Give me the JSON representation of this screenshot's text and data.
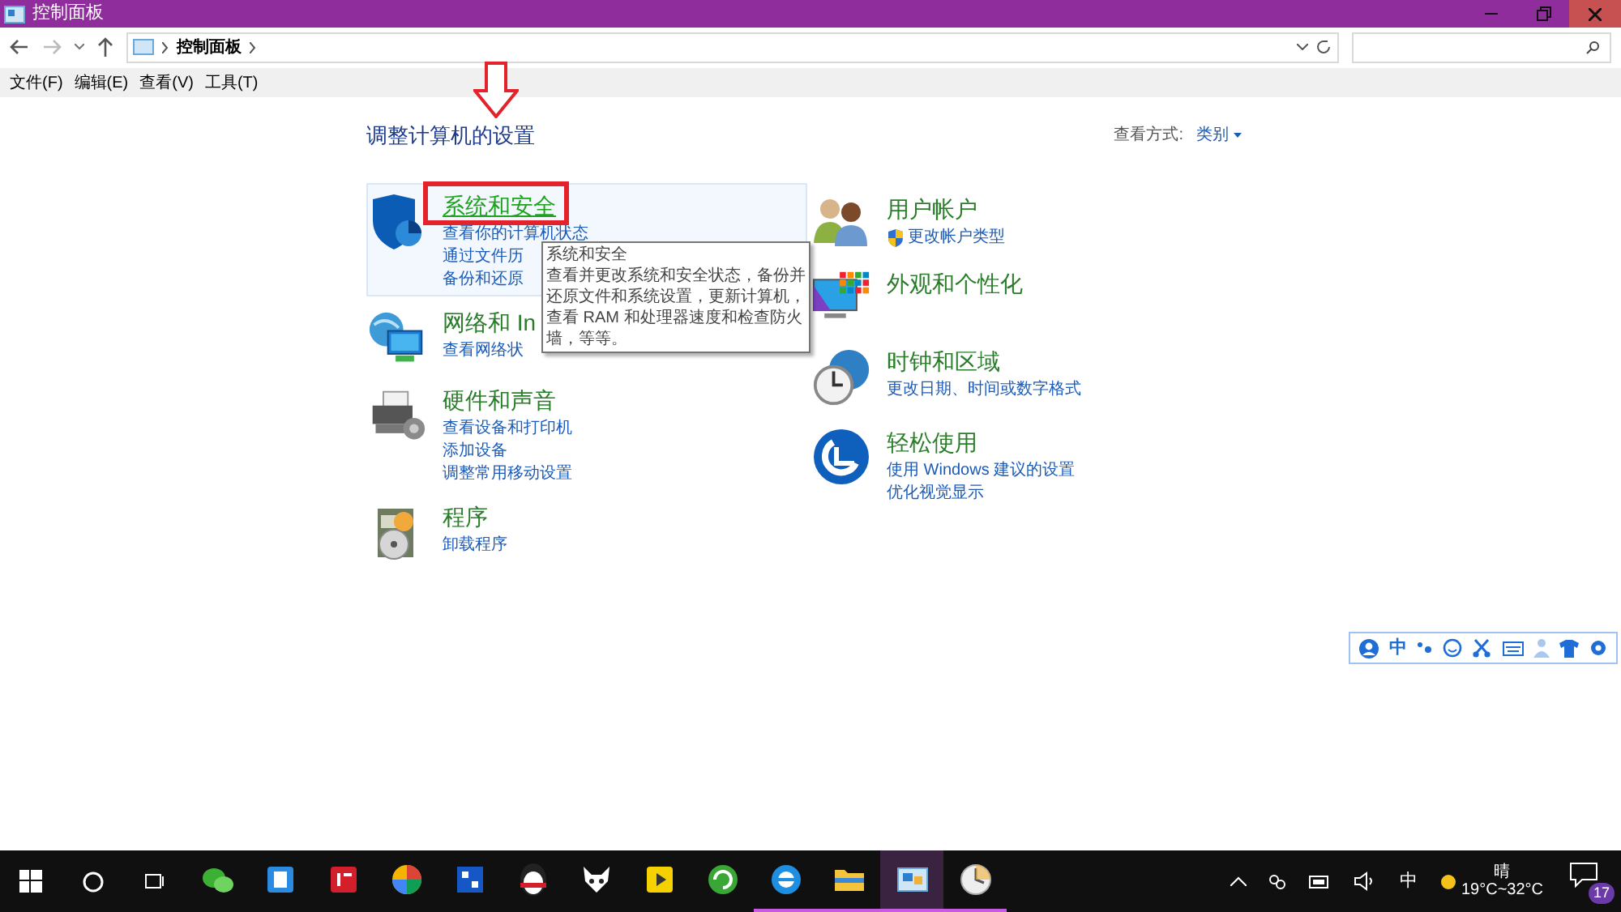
{
  "window": {
    "title": "控制面板"
  },
  "address_bar": {
    "path": "控制面板"
  },
  "menu": [
    "文件(F)",
    "编辑(E)",
    "查看(V)",
    "工具(T)"
  ],
  "heading": "调整计算机的设置",
  "view_by": {
    "label": "查看方式:",
    "value": "类别"
  },
  "left_categories": [
    {
      "kind": "security",
      "title": "系统和安全",
      "selected": true,
      "links": [
        "查看你的计算机状态",
        "通过文件历",
        "备份和还原"
      ]
    },
    {
      "kind": "network",
      "title": "网络和 In",
      "selected": false,
      "links": [
        "查看网络状"
      ]
    },
    {
      "kind": "hardware",
      "title": "硬件和声音",
      "selected": false,
      "links": [
        "查看设备和打印机",
        "添加设备",
        "调整常用移动设置"
      ]
    },
    {
      "kind": "programs",
      "title": "程序",
      "selected": false,
      "links": [
        "卸载程序"
      ]
    }
  ],
  "right_categories": [
    {
      "kind": "accounts",
      "title": "用户帐户",
      "selected": false,
      "links": [
        "更改帐户类型"
      ]
    },
    {
      "kind": "appearance",
      "title": "外观和个性化",
      "selected": false
    },
    {
      "kind": "region",
      "title": "时钟和区域",
      "selected": false,
      "links": [
        "更改日期、时间或数字格式"
      ]
    },
    {
      "kind": "access",
      "title": "轻松使用",
      "selected": false,
      "links": [
        "使用 Windows 建议的设置",
        "优化视觉显示"
      ]
    }
  ],
  "tooltip": {
    "title": "系统和安全",
    "body": "查看并更改系统和安全状态，备份并还原文件和系统设置，更新计算机，查看 RAM 和处理器速度和检查防火墙，等等。"
  },
  "ime_toolbar": {
    "mode": "中"
  },
  "taskbar": {
    "apps": [
      {
        "kind": "wechat",
        "open": false,
        "active": false
      },
      {
        "kind": "blue",
        "open": false,
        "active": false
      },
      {
        "kind": "red",
        "open": false,
        "active": false
      },
      {
        "kind": "colorful",
        "open": false,
        "active": false
      },
      {
        "kind": "tools",
        "open": false,
        "active": false
      },
      {
        "kind": "penguin",
        "open": false,
        "active": false
      },
      {
        "kind": "fox",
        "open": false,
        "active": false
      },
      {
        "kind": "player",
        "open": false,
        "active": false
      },
      {
        "kind": "green",
        "open": false,
        "active": false
      },
      {
        "kind": "ie",
        "open": true,
        "active": false
      },
      {
        "kind": "folder",
        "open": true,
        "active": false
      },
      {
        "kind": "panel",
        "open": true,
        "active": true
      },
      {
        "kind": "clock",
        "open": true,
        "active": false
      }
    ],
    "ime": "中",
    "weather": "晴",
    "temperature": "19°C~32°C",
    "notifications": "17"
  }
}
